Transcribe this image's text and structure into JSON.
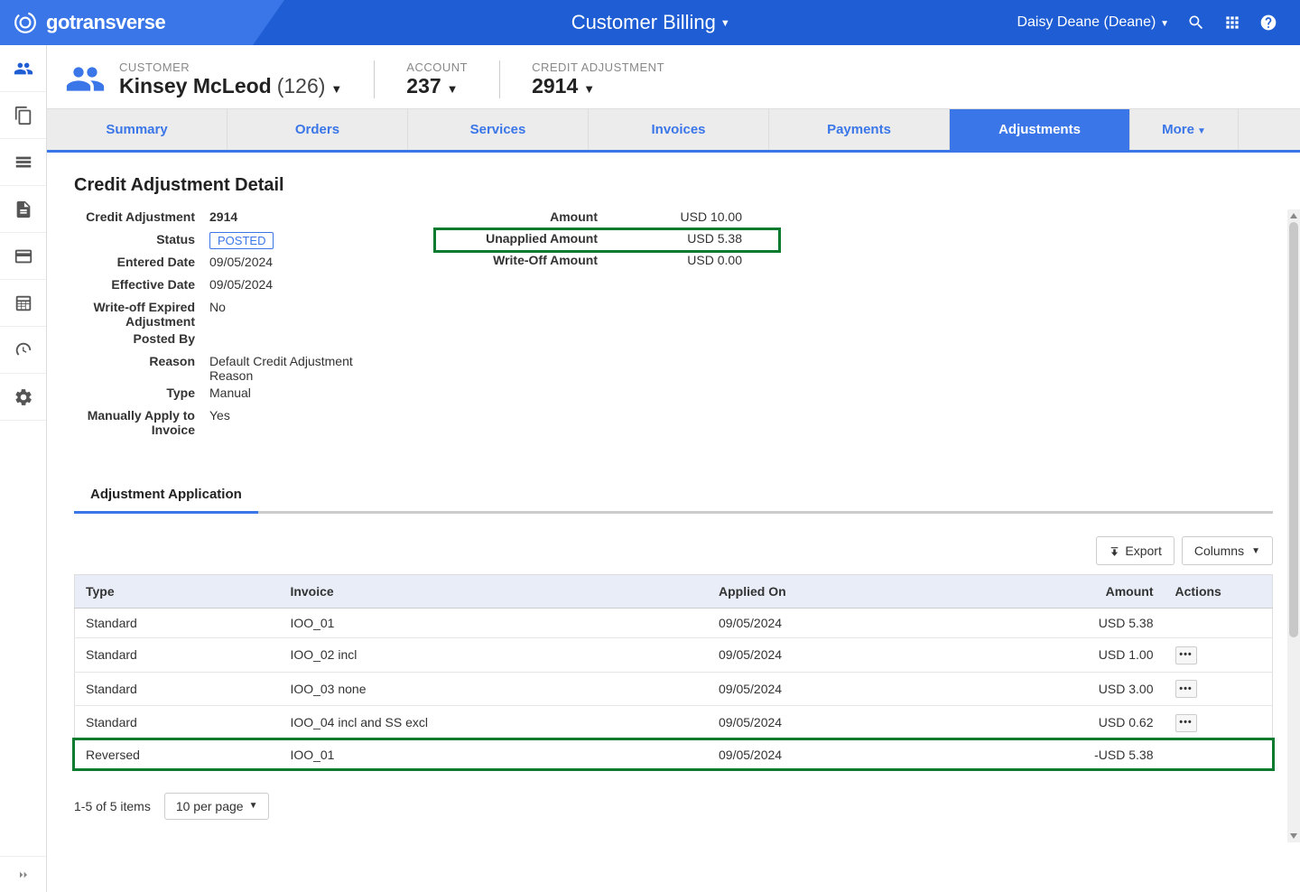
{
  "header": {
    "brand": "gotransverse",
    "title": "Customer Billing",
    "user": "Daisy Deane (Deane)"
  },
  "breadcrumb": {
    "customer": {
      "label": "CUSTOMER",
      "name": "Kinsey McLeod",
      "id": "(126)"
    },
    "account": {
      "label": "ACCOUNT",
      "value": "237"
    },
    "adjustment": {
      "label": "CREDIT ADJUSTMENT",
      "value": "2914"
    }
  },
  "tabs": [
    "Summary",
    "Orders",
    "Services",
    "Invoices",
    "Payments",
    "Adjustments",
    "More"
  ],
  "active_tab": "Adjustments",
  "section_title": "Credit Adjustment Detail",
  "details_left": [
    {
      "label": "Credit Adjustment",
      "value": "2914",
      "bold": true
    },
    {
      "label": "Status",
      "value": "POSTED",
      "badge": true
    },
    {
      "label": "Entered Date",
      "value": "09/05/2024"
    },
    {
      "label": "Effective Date",
      "value": "09/05/2024"
    },
    {
      "label": "Write-off Expired Adjustment",
      "value": "No"
    },
    {
      "label": "Posted By",
      "value": ""
    },
    {
      "label": "Reason",
      "value": "Default Credit Adjustment Reason"
    },
    {
      "label": "Type",
      "value": "Manual"
    },
    {
      "label": "Manually Apply to Invoice",
      "value": "Yes"
    }
  ],
  "details_right": [
    {
      "label": "Amount",
      "value": "USD 10.00"
    },
    {
      "label": "Unapplied Amount",
      "value": "USD 5.38",
      "highlight": true
    },
    {
      "label": "Write-Off Amount",
      "value": "USD 0.00"
    }
  ],
  "sub_tab": "Adjustment Application",
  "toolbar": {
    "export": "Export",
    "columns": "Columns"
  },
  "table": {
    "headers": [
      "Type",
      "Invoice",
      "Applied On",
      "Amount",
      "Actions"
    ],
    "rows": [
      {
        "type": "Standard",
        "invoice": "IOO_01",
        "applied_on": "09/05/2024",
        "amount": "USD 5.38",
        "actions": false
      },
      {
        "type": "Standard",
        "invoice": "IOO_02 incl",
        "applied_on": "09/05/2024",
        "amount": "USD 1.00",
        "actions": true
      },
      {
        "type": "Standard",
        "invoice": "IOO_03 none",
        "applied_on": "09/05/2024",
        "amount": "USD 3.00",
        "actions": true
      },
      {
        "type": "Standard",
        "invoice": "IOO_04 incl and SS excl",
        "applied_on": "09/05/2024",
        "amount": "USD 0.62",
        "actions": true
      },
      {
        "type": "Reversed",
        "invoice": "IOO_01",
        "applied_on": "09/05/2024",
        "amount": "-USD 5.38",
        "actions": false,
        "highlight": true
      }
    ]
  },
  "pagination": {
    "summary": "1-5 of 5 items",
    "per_page": "10 per page"
  }
}
